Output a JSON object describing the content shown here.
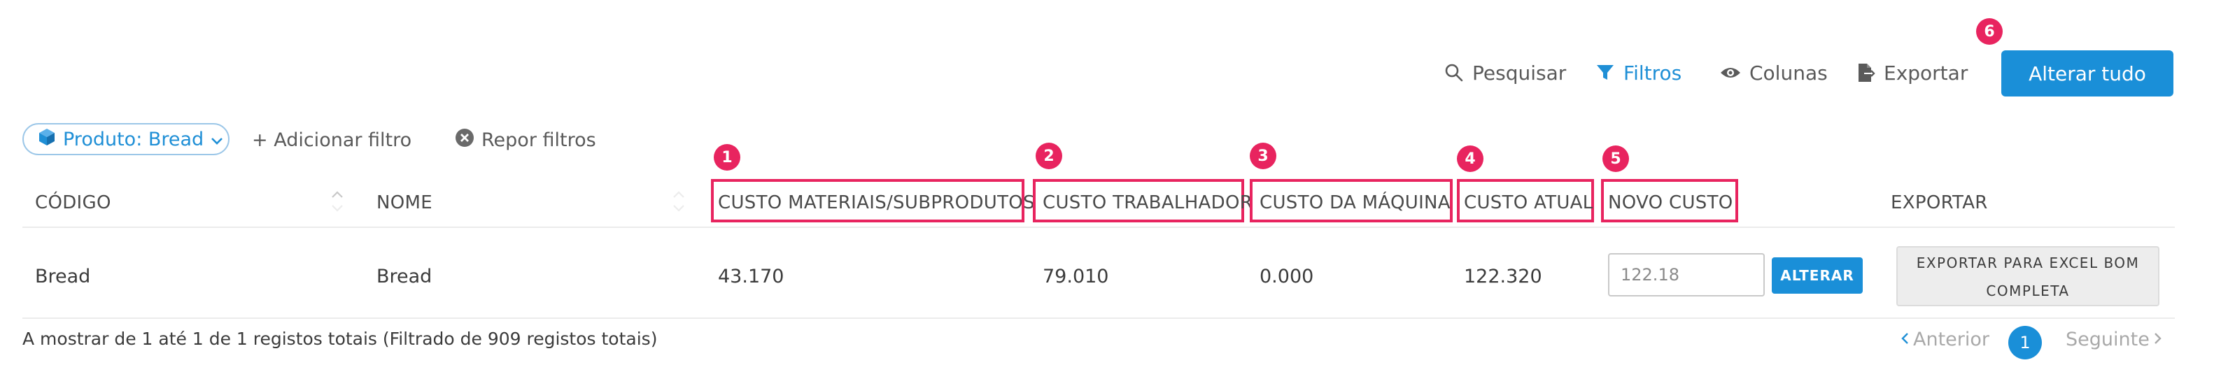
{
  "toolbar": {
    "search_label": "Pesquisar",
    "filters_label": "Filtros",
    "columns_label": "Colunas",
    "export_label": "Exportar",
    "alter_all_label": "Alterar tudo"
  },
  "filters": {
    "chip_label": "Produto: Bread",
    "add_filter_label": "+ Adicionar filtro",
    "reset_filters_label": "Repor filtros"
  },
  "badges": [
    "1",
    "2",
    "3",
    "4",
    "5",
    "6"
  ],
  "table": {
    "columns": [
      "CÓDIGO",
      "NOME",
      "CUSTO MATERIAIS/SUBPRODUTOS",
      "CUSTO TRABALHADOR",
      "CUSTO DA MÁQUINA",
      "CUSTO ATUAL",
      "NOVO CUSTO",
      "EXPORTAR"
    ],
    "rows": [
      {
        "codigo": "Bread",
        "nome": "Bread",
        "custo_materiais": "43.170",
        "custo_trabalhador": "79.010",
        "custo_maquina": "0.000",
        "custo_atual": "122.320",
        "novo_custo": "122.18",
        "alterar_label": "ALTERAR",
        "export_line1": "EXPORTAR PARA EXCEL BOM",
        "export_line2": "COMPLETA"
      }
    ]
  },
  "footer": {
    "summary": "A mostrar de 1 até 1 de 1 registos totais (Filtrado de 909 registos totais)",
    "prev_label": "Anterior",
    "current_page": "1",
    "next_label": "Seguinte"
  },
  "colors": {
    "accent": "#1a8fd8",
    "highlight": "#e8245f"
  }
}
